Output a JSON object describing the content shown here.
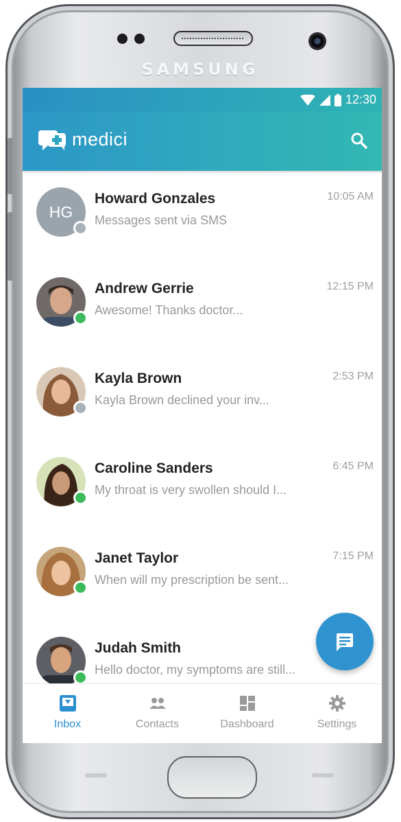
{
  "device": {
    "brand": "SAMSUNG"
  },
  "status_bar": {
    "time": "12:30"
  },
  "app_bar": {
    "app_name": "medici"
  },
  "messages": [
    {
      "name": "Howard Gonzales",
      "preview": "Messages sent via SMS",
      "time": "10:05 AM",
      "avatar_initials": "HG",
      "presence": "offline"
    },
    {
      "name": "Andrew Gerrie",
      "preview": "Awesome! Thanks doctor...",
      "time": "12:15 PM",
      "presence": "online"
    },
    {
      "name": "Kayla Brown",
      "preview": "Kayla Brown declined your inv...",
      "time": "2:53 PM",
      "presence": "offline"
    },
    {
      "name": "Caroline Sanders",
      "preview": "My throat is very swollen should I...",
      "time": "6:45 PM",
      "presence": "online"
    },
    {
      "name": "Janet Taylor",
      "preview": "When will my prescription be sent...",
      "time": "7:15 PM",
      "presence": "online"
    },
    {
      "name": "Judah Smith",
      "preview": "Hello doctor, my symptoms are still...",
      "time": "",
      "presence": "online"
    }
  ],
  "bottom_nav": [
    {
      "label": "Inbox",
      "icon": "inbox-icon",
      "active": true
    },
    {
      "label": "Contacts",
      "icon": "contacts-icon",
      "active": false
    },
    {
      "label": "Dashboard",
      "icon": "dashboard-icon",
      "active": false
    },
    {
      "label": "Settings",
      "icon": "gear-icon",
      "active": false
    }
  ],
  "colors": {
    "header_start": "#2c97c8",
    "header_end": "#33b8b3",
    "accent": "#2a8fd0",
    "online": "#3dbb5c",
    "offline": "#a9b1b8"
  }
}
